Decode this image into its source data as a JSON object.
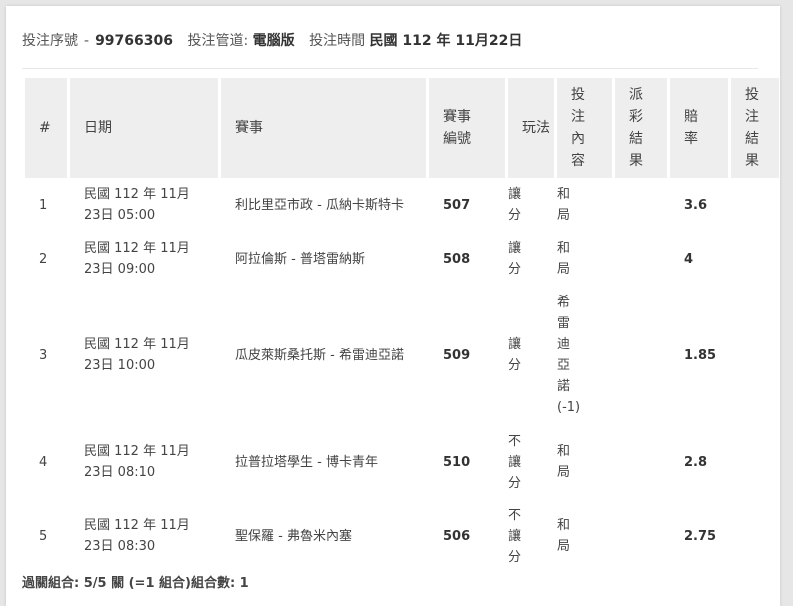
{
  "ticket": {
    "serial_label": "投注序號",
    "dash": "-",
    "serial_value": "99766306",
    "channel_label": "投注管道:",
    "channel_value": "電腦版",
    "time_label": "投注時間",
    "time_value": "民國 112 年 11月22日"
  },
  "table": {
    "headers": {
      "index": "#",
      "date": "日期",
      "match": "賽事",
      "match_no": "賽事編號",
      "play": "玩法",
      "bet_content": "投注內容",
      "payout": "派彩結果",
      "odds": "賠率",
      "bet_result": "投注結果"
    },
    "rows": [
      {
        "index": "1",
        "date_line1": "民國 112 年 11月",
        "date_line2": "23日 05:00",
        "match": "利比里亞市政 - 瓜納卡斯特卡",
        "match_no": "507",
        "play": "讓分",
        "content": "和局",
        "payout": "",
        "odds": "3.6",
        "result": ""
      },
      {
        "index": "2",
        "date_line1": "民國 112 年 11月",
        "date_line2": "23日 09:00",
        "match": "阿拉倫斯 - 普塔雷納斯",
        "match_no": "508",
        "play": "讓分",
        "content": "和局",
        "payout": "",
        "odds": "4",
        "result": ""
      },
      {
        "index": "3",
        "date_line1": "民國 112 年 11月",
        "date_line2": "23日 10:00",
        "match": "瓜皮萊斯桑托斯 - 希雷迪亞諾",
        "match_no": "509",
        "play": "讓分",
        "content": "希雷迪亞諾",
        "content_extra": "(-1)",
        "payout": "",
        "odds": "1.85",
        "result": ""
      },
      {
        "index": "4",
        "date_line1": "民國 112 年 11月",
        "date_line2": "23日 08:10",
        "match": "拉普拉塔學生 - 博卡青年",
        "match_no": "510",
        "play": "不讓分",
        "content": "和局",
        "payout": "",
        "odds": "2.8",
        "result": ""
      },
      {
        "index": "5",
        "date_line1": "民國 112 年 11月",
        "date_line2": "23日 08:30",
        "match": "聖保羅 - 弗魯米內塞",
        "match_no": "506",
        "play": "不讓分",
        "content": "和局",
        "payout": "",
        "odds": "2.75",
        "result": ""
      }
    ]
  },
  "footer": {
    "summary": "過關組合: 5/5 關 (=1 組合)組合數: 1"
  }
}
